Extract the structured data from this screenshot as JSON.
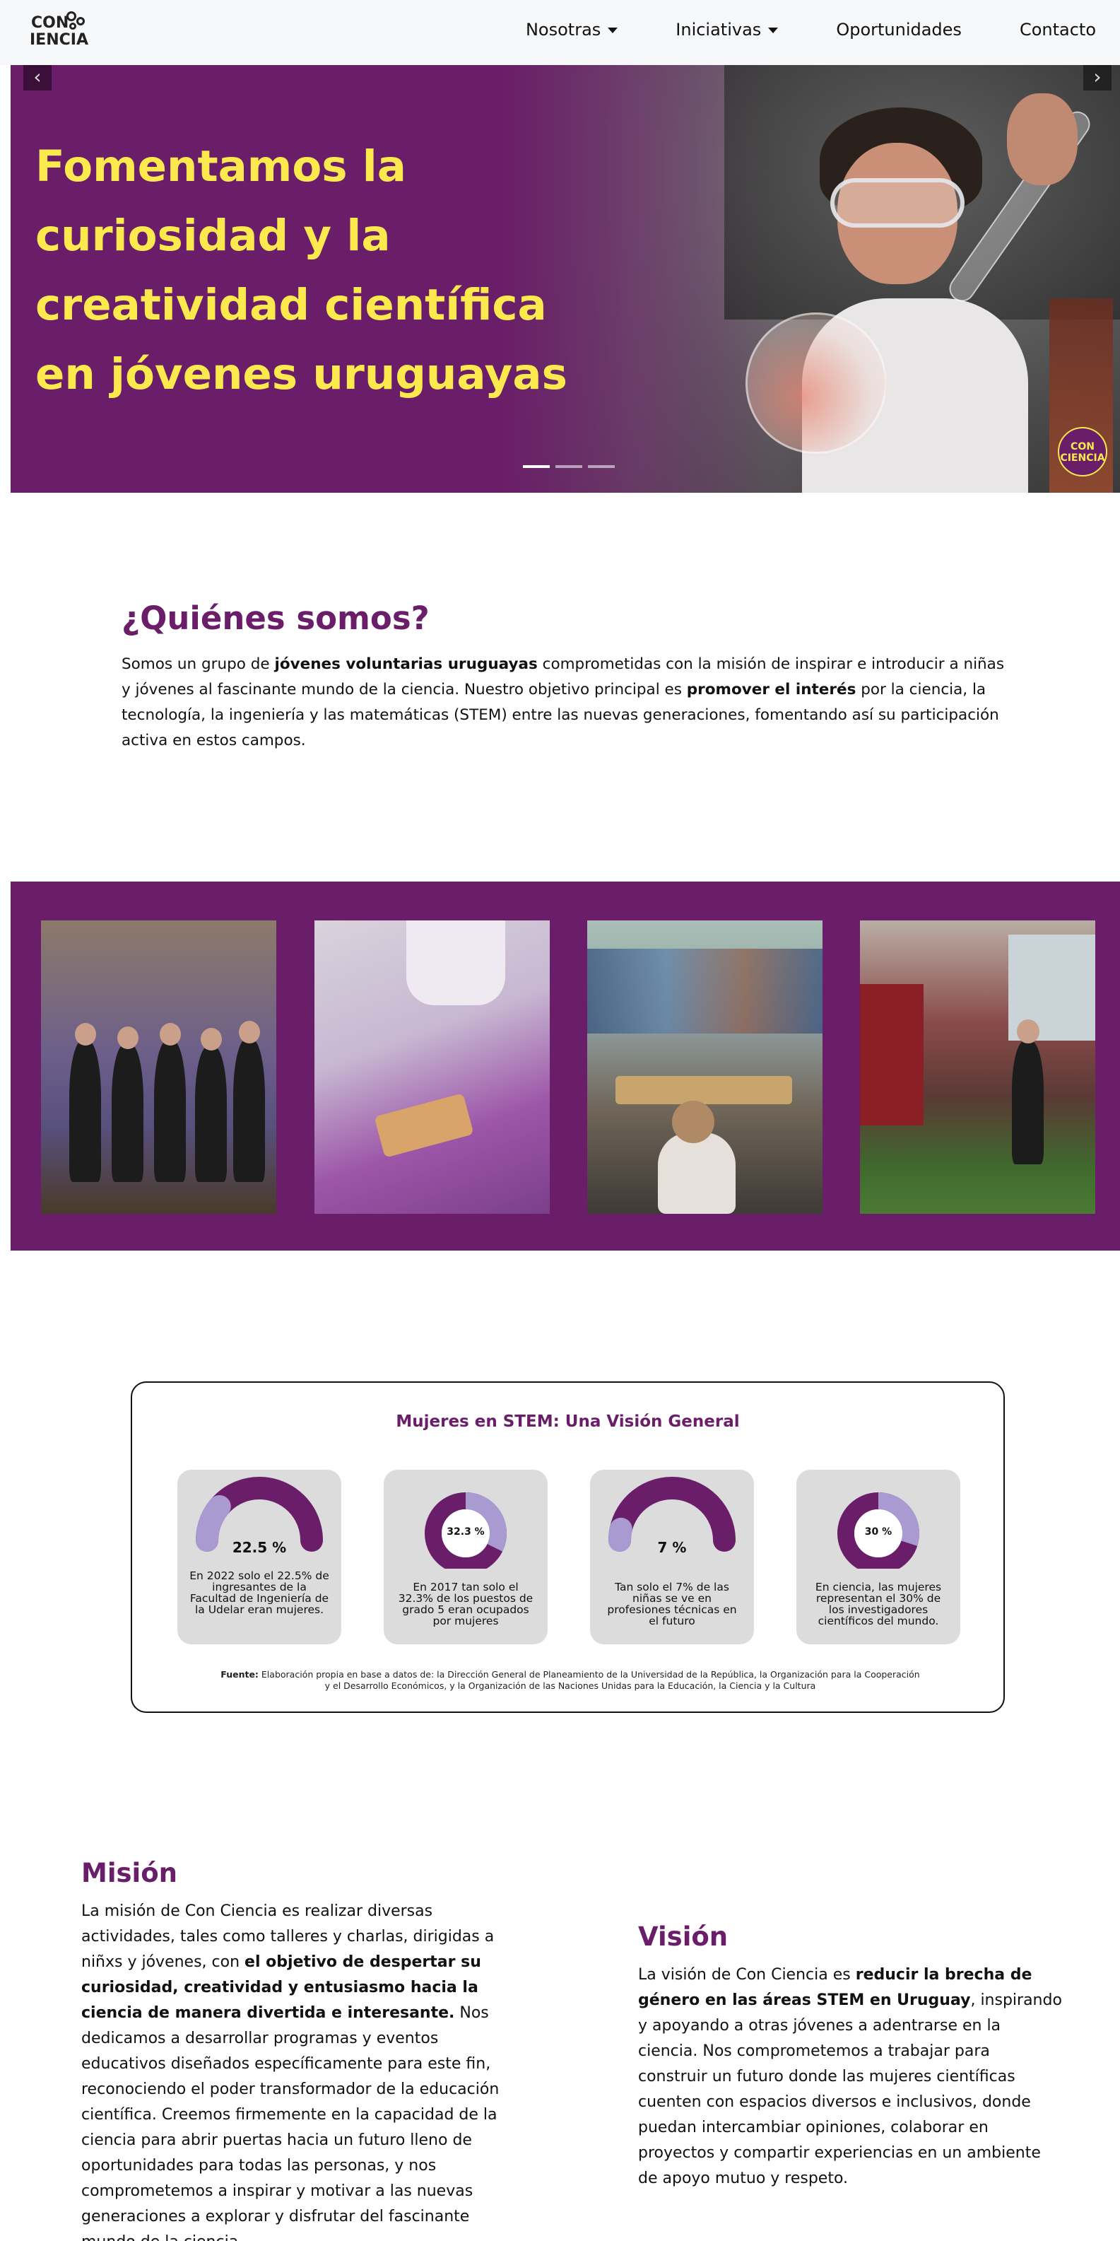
{
  "nav": {
    "logo_top": "CON",
    "logo_bottom": "IENCIA",
    "items": [
      {
        "label": "Nosotras",
        "dropdown": true
      },
      {
        "label": "Iniciativas",
        "dropdown": true
      },
      {
        "label": "Oportunidades",
        "dropdown": false
      },
      {
        "label": "Contacto",
        "dropdown": false
      }
    ]
  },
  "hero": {
    "title": "Fomentamos la curiosidad y la creatividad científica en jóvenes uruguayas",
    "prev_icon": "chevron-left-icon",
    "next_icon": "chevron-right-icon",
    "slides_count": 3,
    "active_slide": 1,
    "badge_text": "CON CIENCIA"
  },
  "quienes": {
    "title": "¿Quiénes somos?",
    "text_1": "Somos un grupo de ",
    "bold_1": "jóvenes voluntarias uruguayas",
    "text_2": " comprometidas con la misión de inspirar e introducir a niñas y jóvenes al fascinante mundo de la ciencia. Nuestro objetivo principal es ",
    "bold_2": "promover el interés",
    "text_3": " por la ciencia, la tecnología, la ingeniería y las matemáticas (STEM) entre las nuevas generaciones, fomentando así su participación activa en estos campos."
  },
  "stats": {
    "title": "Mujeres en STEM: Una Visión General",
    "cards": [
      {
        "value": "22.5 %",
        "desc": "En 2022 solo el 22.5% de ingresantes de la Facultad de Ingeniería de la Udelar eran mujeres.",
        "percent": 22.5,
        "shape": "arc"
      },
      {
        "value": "32.3 %",
        "desc": "En 2017 tan solo el 32.3% de los puestos de grado 5 eran ocupados por mujeres",
        "percent": 32.3,
        "shape": "donut"
      },
      {
        "value": "7 %",
        "desc": "Tan solo el 7% de las niñas se ve en profesiones técnicas en el futuro",
        "percent": 7,
        "shape": "arc"
      },
      {
        "value": "30 %",
        "desc": "En ciencia, las mujeres representan el 30% de los investigadores científicos del mundo.",
        "percent": 30,
        "shape": "donut"
      }
    ],
    "source_label": "Fuente:",
    "source_text": " Elaboración propia en base a datos de: la Dirección General de Planeamiento de la Universidad de la República, la Organización para la Cooperación y el Desarrollo Económicos, y la Organización de las Naciones Unidas para la Educación, la Ciencia y la Cultura",
    "colors": {
      "main": "#6a1d68",
      "accent": "#a99ad1",
      "card_bg": "#dcdcdc"
    }
  },
  "mision": {
    "title": "Misión",
    "text_1": "La misión de Con Ciencia es realizar diversas actividades, tales como talleres y charlas, dirigidas a niñxs y jóvenes, con ",
    "bold_1": "el objetivo de despertar su curiosidad, creatividad y entusiasmo hacia la ciencia de manera divertida e interesante.",
    "text_2": " Nos dedicamos a desarrollar programas y eventos educativos diseñados específicamente para este fin, reconociendo el poder transformador de la educación científica. Creemos firmemente en la capacidad de la ciencia para abrir puertas hacia un futuro lleno de oportunidades para todas las personas, y nos comprometemos a inspirar y motivar a las nuevas generaciones a explorar y disfrutar del fascinante mundo de la ciencia."
  },
  "vision": {
    "title": "Visión",
    "text_1": "La visión de Con Ciencia es ",
    "bold_1": "reducir la brecha de género en las áreas STEM en Uruguay",
    "text_2": ", inspirando y apoyando a otras jóvenes a adentrarse en la ciencia. Nos comprometemos a trabajar para construir un futuro donde las mujeres científicas cuenten con espacios diversos e inclusivos, donde puedan intercambiar opiniones, colaborar en proyectos y compartir experiencias en un ambiente de apoyo mutuo y respeto."
  },
  "colors": {
    "brand_purple": "#6a1d68",
    "hero_yellow": "#fce94e",
    "nav_bg": "#f7f8fa"
  }
}
